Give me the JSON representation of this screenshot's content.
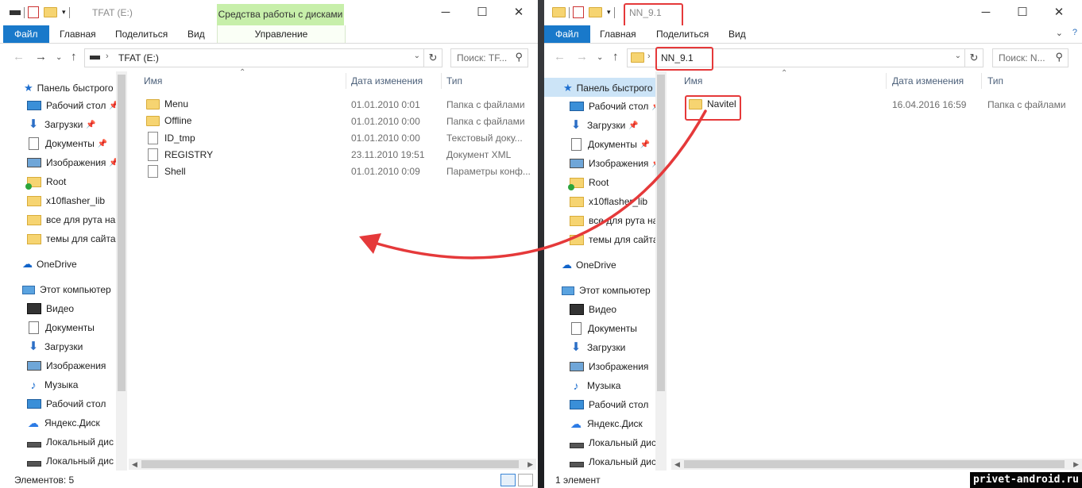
{
  "left": {
    "title": "TFAT (E:)",
    "context_tab_header": "Средства работы с дисками",
    "tabs": [
      "Файл",
      "Главная",
      "Поделиться",
      "Вид"
    ],
    "context_tab": "Управление",
    "address": "TFAT (E:)",
    "search_placeholder": "Поиск: TF...",
    "columns": {
      "name": "Имя",
      "date": "Дата изменения",
      "type": "Тип"
    },
    "files": [
      {
        "name": "Menu",
        "date": "01.01.2010 0:01",
        "type": "Папка с файлами",
        "icon": "folder"
      },
      {
        "name": "Offline",
        "date": "01.01.2010 0:00",
        "type": "Папка с файлами",
        "icon": "folder"
      },
      {
        "name": "ID_tmp",
        "date": "01.01.2010 0:00",
        "type": "Текстовый доку...",
        "icon": "file"
      },
      {
        "name": "REGISTRY",
        "date": "23.11.2010 19:51",
        "type": "Документ XML",
        "icon": "file"
      },
      {
        "name": "Shell",
        "date": "01.01.2010 0:09",
        "type": "Параметры конф...",
        "icon": "file"
      }
    ],
    "status": "Элементов: 5"
  },
  "right": {
    "title": "NN_9.1",
    "tabs": [
      "Файл",
      "Главная",
      "Поделиться",
      "Вид"
    ],
    "address": "NN_9.1",
    "search_placeholder": "Поиск: N...",
    "columns": {
      "name": "Имя",
      "date": "Дата изменения",
      "type": "Тип"
    },
    "files": [
      {
        "name": "Navitel",
        "date": "16.04.2016 16:59",
        "type": "Папка с файлами",
        "icon": "folder"
      }
    ],
    "status": "1 элемент"
  },
  "nav": {
    "quick_access": "Панель быстрого доступа",
    "items": [
      {
        "label": "Рабочий стол",
        "pinned": true,
        "icon": "desktop-icon"
      },
      {
        "label": "Загрузки",
        "pinned": true,
        "icon": "downloads-icon"
      },
      {
        "label": "Документы",
        "pinned": true,
        "icon": "documents-icon"
      },
      {
        "label": "Изображения",
        "pinned": true,
        "icon": "pictures-icon"
      },
      {
        "label": "Root",
        "pinned": false,
        "icon": "folder-check-icon"
      },
      {
        "label": "x10flasher_lib",
        "pinned": false,
        "icon": "folder-icon"
      },
      {
        "label": "все для рута на",
        "pinned": false,
        "icon": "folder-icon"
      },
      {
        "label": "темы для сайта",
        "pinned": false,
        "icon": "folder-icon"
      }
    ],
    "onedrive": "OneDrive",
    "this_pc": "Этот компьютер",
    "pc_items": [
      {
        "label": "Видео",
        "icon": "video-icon"
      },
      {
        "label": "Документы",
        "icon": "documents-icon"
      },
      {
        "label": "Загрузки",
        "icon": "downloads-icon"
      },
      {
        "label": "Изображения",
        "icon": "pictures-icon"
      },
      {
        "label": "Музыка",
        "icon": "music-icon"
      },
      {
        "label": "Рабочий стол",
        "icon": "desktop-icon"
      },
      {
        "label": "Яндекс.Диск",
        "icon": "cloud-icon"
      },
      {
        "label": "Локальный дис",
        "icon": "drive-icon"
      },
      {
        "label": "Локальный дис",
        "icon": "drive-icon"
      }
    ]
  },
  "watermark": "privet-android.ru",
  "colors": {
    "accent": "#1979ca",
    "context": "#c7efaa",
    "highlight": "#e5393a"
  }
}
